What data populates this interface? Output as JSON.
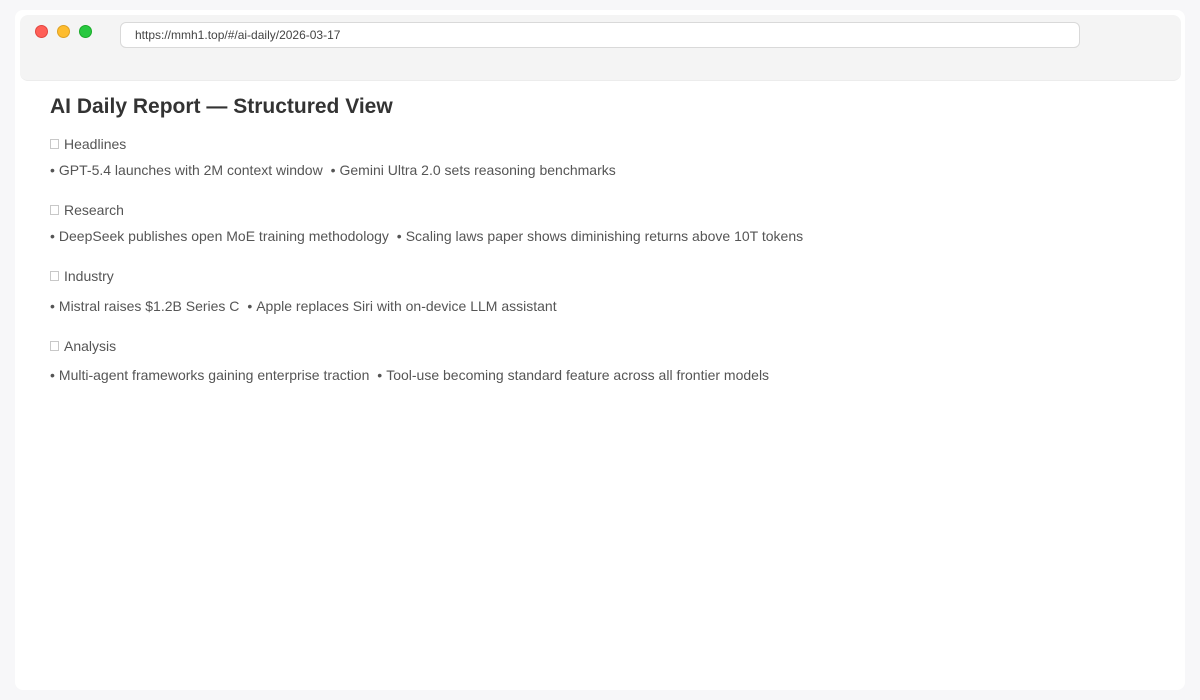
{
  "browser": {
    "url": "https://mmh1.top/#/ai-daily/2026-03-17"
  },
  "page": {
    "title": "AI Daily Report — Structured View"
  },
  "sections": [
    {
      "heading": "Headlines",
      "items": [
        "GPT-5.4 launches with 2M context window",
        "Gemini Ultra 2.0 sets reasoning benchmarks"
      ]
    },
    {
      "heading": "Research",
      "items": [
        "DeepSeek publishes open MoE training methodology",
        "Scaling laws paper shows diminishing returns above 10T tokens"
      ]
    },
    {
      "heading": "Industry",
      "items": [
        "Mistral raises $1.2B Series C",
        "Apple replaces Siri with on-device LLM assistant"
      ]
    },
    {
      "heading": "Analysis",
      "items": [
        "Multi-agent frameworks gaining enterprise traction",
        "Tool-use becoming standard feature across all frontier models"
      ]
    }
  ],
  "bullet_glyph": "•"
}
